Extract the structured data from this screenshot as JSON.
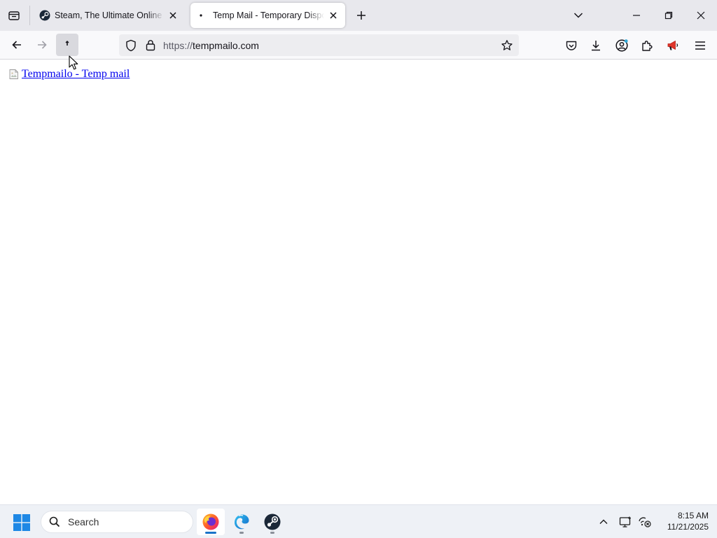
{
  "browser": {
    "tabs": [
      {
        "title": "Steam, The Ultimate Online Game Platform",
        "favicon": "steam-icon",
        "active": false
      },
      {
        "title": "Temp Mail - Temporary Disposable Email",
        "favicon": "page-loading-icon",
        "active": true
      }
    ],
    "url": {
      "scheme": "https://",
      "host": "tempmailo.com"
    },
    "icons": [
      "tab-list-icon",
      "new-tab-icon",
      "list-all-tabs-icon",
      "back-icon",
      "forward-icon",
      "reload-icon",
      "shield-icon",
      "lock-icon",
      "bookmark-star-icon",
      "pocket-icon",
      "download-icon",
      "account-icon",
      "extensions-icon",
      "megaphone-icon",
      "hamburger-menu-icon",
      "minimize-icon",
      "restore-icon",
      "close-icon"
    ]
  },
  "page": {
    "link_text": "Tempmailo - Temp mail"
  },
  "taskbar": {
    "search_label": "Search",
    "apps": [
      "firefox-icon",
      "edge-icon",
      "steam-icon"
    ],
    "clock": {
      "time": "8:15 AM",
      "date": "11/21/2025"
    }
  },
  "colors": {
    "link": "#0000ee",
    "tabstrip_bg": "#e8e8ed",
    "navbar_bg": "#f9f9fb",
    "taskbar_bg": "#eef1f6",
    "active_indicator": "#1a73c8"
  }
}
